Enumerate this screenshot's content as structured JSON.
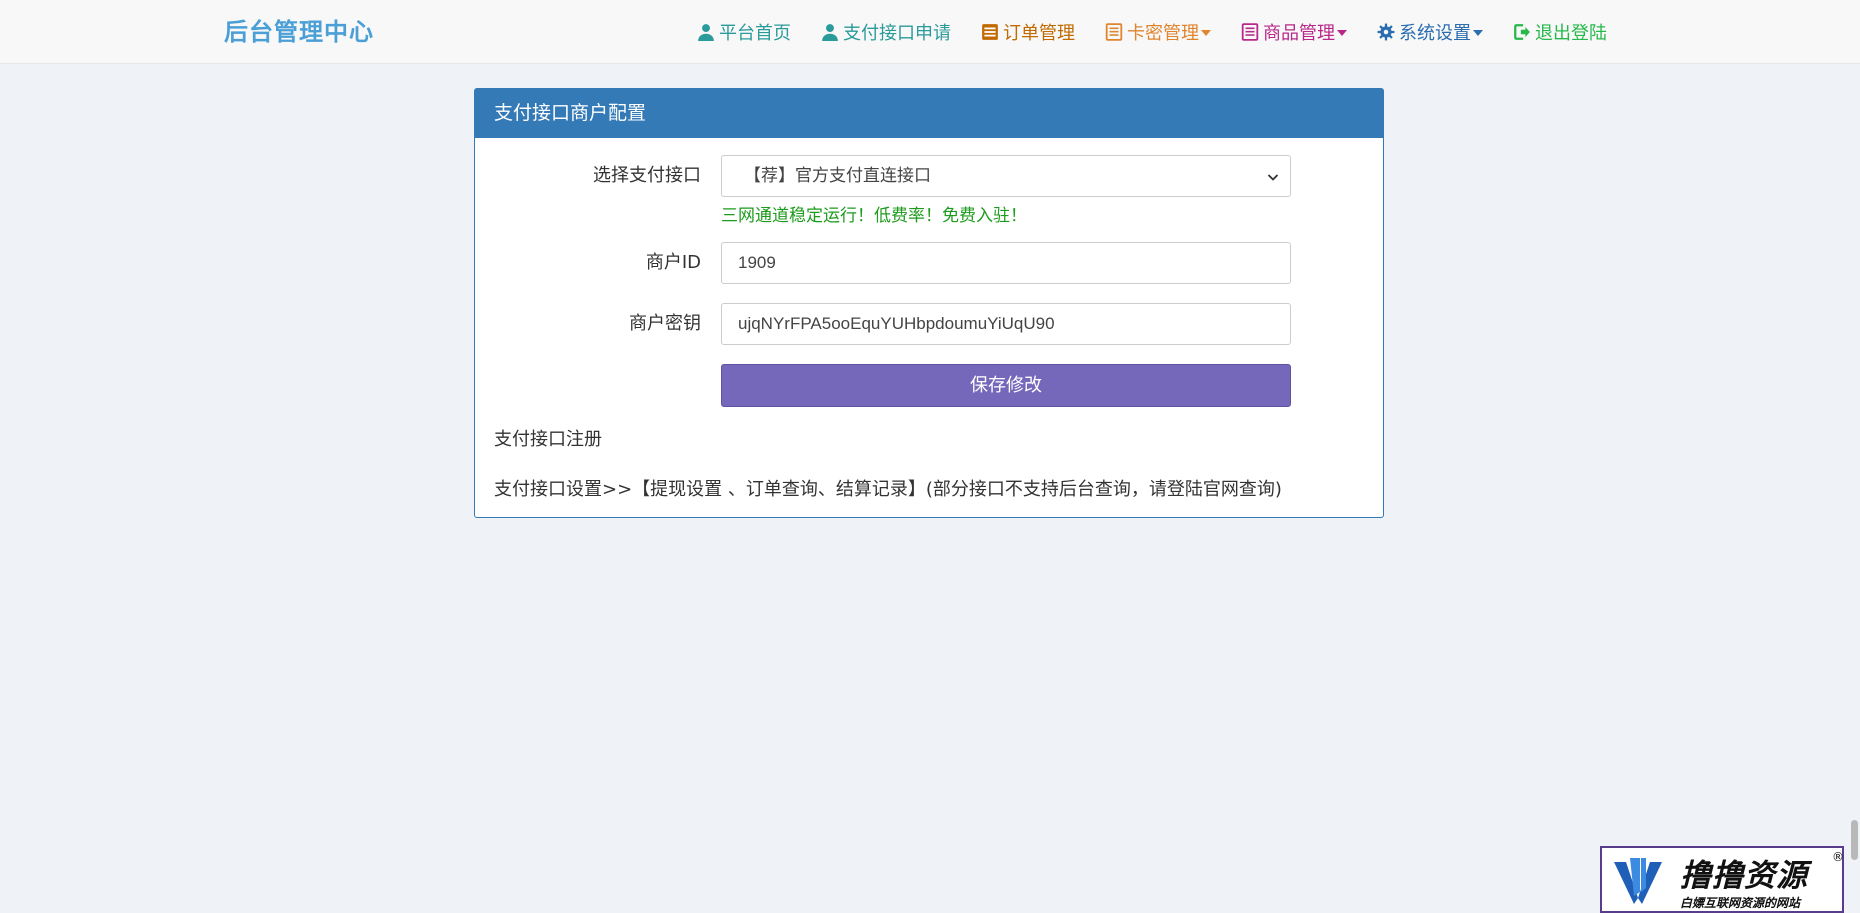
{
  "navbar": {
    "brand": "后台管理中心",
    "items": [
      {
        "label": "平台首页",
        "icon": "user-icon",
        "color": "#2a9a9a"
      },
      {
        "label": "支付接口申请",
        "icon": "user-icon",
        "color": "#2a9a9a"
      },
      {
        "label": "订单管理",
        "icon": "list-icon",
        "color": "#c06a00"
      },
      {
        "label": "卡密管理",
        "icon": "book-icon",
        "color": "#e0842e"
      },
      {
        "label": "商品管理",
        "icon": "book-icon",
        "color": "#b8288a"
      },
      {
        "label": "系统设置",
        "icon": "gear-icon",
        "color": "#2a6db0"
      },
      {
        "label": "退出登陆",
        "icon": "logout-icon",
        "color": "#27b84c"
      }
    ]
  },
  "panel": {
    "title": "支付接口商户配置",
    "select_label": "选择支付接口",
    "select_value": "【荐】官方支付直连接口",
    "hint": "三网通道稳定运行！低费率！免费入驻！",
    "merchant_id_label": "商户ID",
    "merchant_id_value": "1909",
    "merchant_key_label": "商户密钥",
    "merchant_key_value": "ujqNYrFPA5ooEquYUHbpdoumuYiUqU90",
    "save_label": "保存修改",
    "register_text": "支付接口注册",
    "settings_text": "支付接口设置>>【提现设置 、订单查询、结算记录】(部分接口不支持后台查询，请登陆官网查询)"
  },
  "watermark": {
    "title": "撸撸资源",
    "reg": "®",
    "subtitle": "白嫖互联网资源的网站"
  }
}
